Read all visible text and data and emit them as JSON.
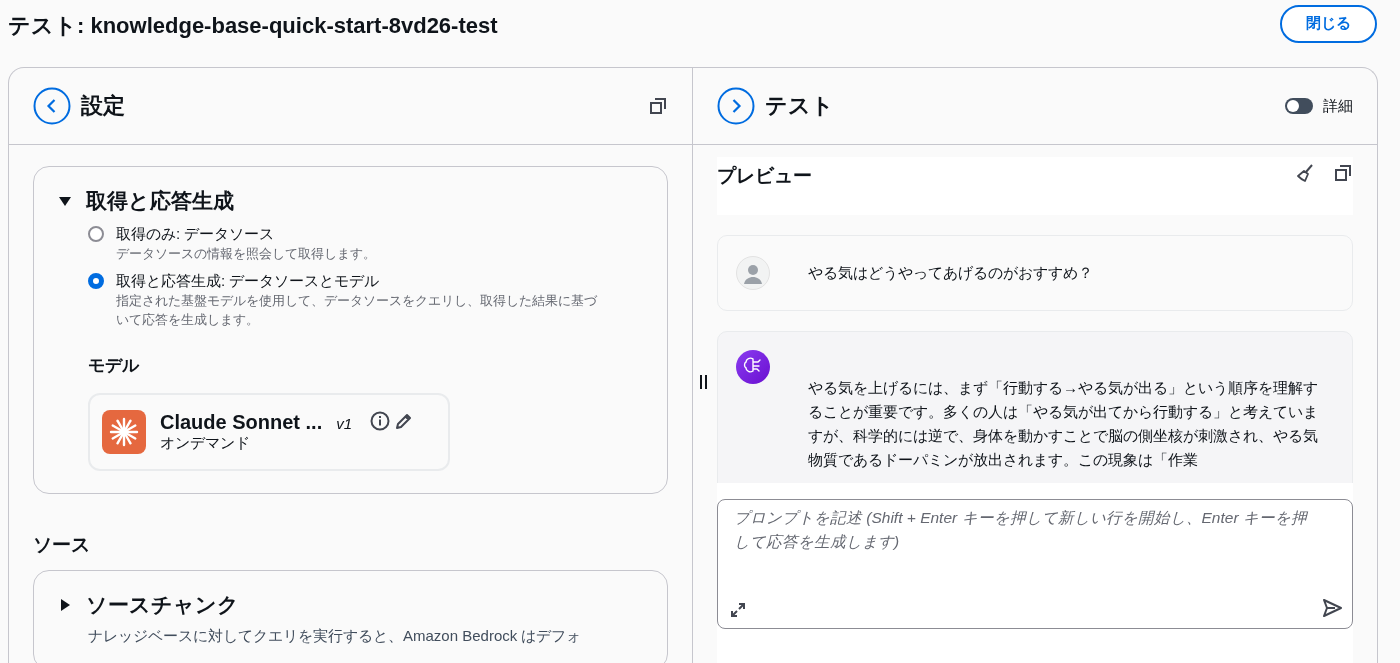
{
  "title": "テスト: knowledge-base-quick-start-8vd26-test",
  "close_button": "閉じる",
  "settings": {
    "title": "設定",
    "mode_section": {
      "title": "取得と応答生成",
      "expanded": true,
      "options": [
        {
          "label": "取得のみ: データソース",
          "description": "データソースの情報を照会して取得します。",
          "selected": false
        },
        {
          "label": "取得と応答生成: データソースとモデル",
          "description": "指定された基盤モデルを使用して、データソースをクエリし、取得した結果に基づいて応答を生成します。",
          "selected": true
        }
      ],
      "model_heading": "モデル",
      "model": {
        "name": "Claude Sonnet ...",
        "version": "v1",
        "mode": "オンデマンド"
      }
    },
    "source_heading": "ソース",
    "source_section": {
      "title": "ソースチャンク",
      "expanded": false,
      "description": "ナレッジベースに対してクエリを実行すると、Amazon Bedrock はデフォ"
    }
  },
  "test": {
    "title": "テスト",
    "details_toggle": {
      "label": "詳細",
      "on": false
    },
    "preview_title": "プレビュー",
    "messages": [
      {
        "kind": "user",
        "text": "やる気はどうやってあげるのがおすすめ？"
      },
      {
        "kind": "assistant",
        "text": "やる気を上げるには、まず「行動する→やる気が出る」という順序を理解することが重要です。多くの人は「やる気が出てから行動する」と考えていますが、科学的には逆で、身体を動かすことで脳の側坐核が刺激され、やる気物質であるドーパミンが放出されます。この現象は「作業"
      }
    ],
    "prompt": {
      "placeholder": "プロンプトを記述 (Shift + Enter キーを押して新しい行を開始し、Enter キーを押して応答を生成します)"
    }
  }
}
